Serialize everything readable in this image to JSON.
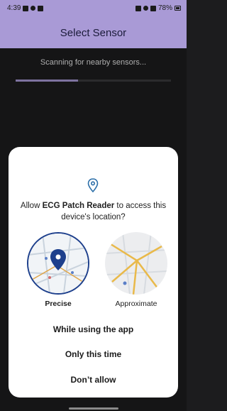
{
  "status_bar": {
    "time": "4:39",
    "battery": "78%"
  },
  "app_bar": {
    "title": "Select Sensor"
  },
  "scan": {
    "text": "Scanning for nearby sensors...",
    "progress": 0.4
  },
  "dialog": {
    "prompt_prefix": "Allow ",
    "app_name": "ECG Patch Reader",
    "prompt_suffix": " to access this device's location?",
    "option_precise": "Precise",
    "option_approximate": "Approximate",
    "choice_while_using": "While using the app",
    "choice_only_this_time": "Only this time",
    "choice_dont_allow": "Don’t allow"
  },
  "colors": {
    "accent": "#a99ad6",
    "pin": "#1d3f8c",
    "background": "#1c1c1e"
  }
}
